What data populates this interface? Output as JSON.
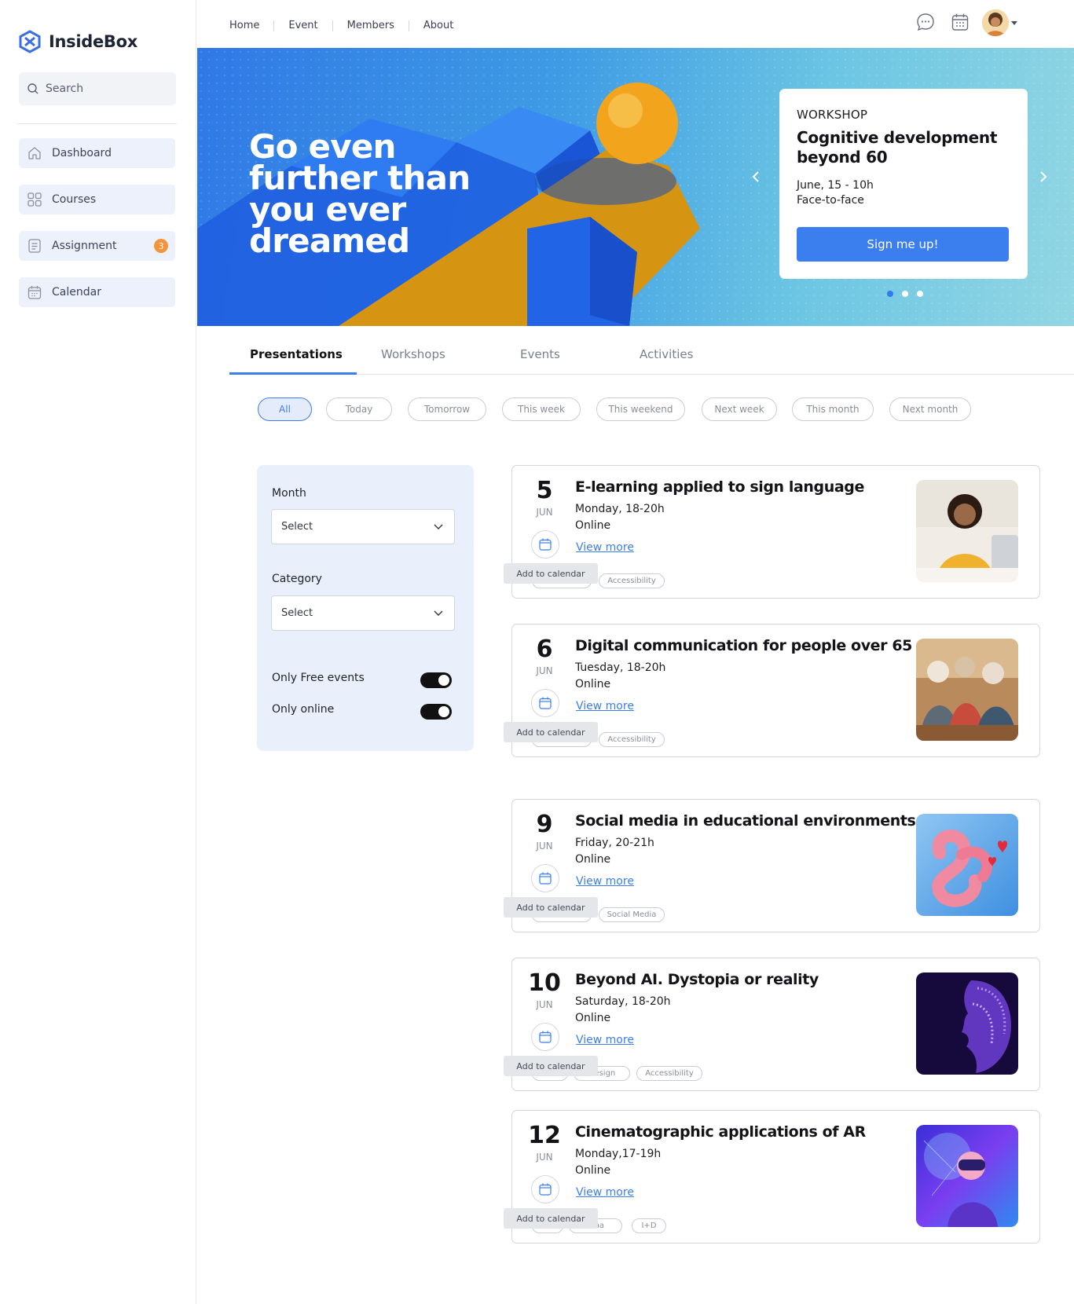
{
  "brand": {
    "name": "InsideBox"
  },
  "search": {
    "placeholder": "Search"
  },
  "sidebar": {
    "items": [
      {
        "label": "Dashboard",
        "icon": "home-icon"
      },
      {
        "label": "Courses",
        "icon": "grid-icon"
      },
      {
        "label": "Assignment",
        "icon": "document-icon",
        "badge": "3"
      },
      {
        "label": "Calendar",
        "icon": "calendar-icon"
      }
    ]
  },
  "topnav": {
    "links": [
      "Home",
      "Event",
      "Members",
      "About"
    ],
    "icons": [
      "chat-icon",
      "calendar-icon",
      "bell-icon"
    ]
  },
  "hero": {
    "title": "Go even further than you ever dreamed",
    "card": {
      "kind": "WORKSHOP",
      "title": "Cognitive development beyond 60",
      "date": "June, 15 - 10h",
      "mode": "Face-to-face",
      "cta": "Sign me up!"
    },
    "slides": 3,
    "active_slide": 1
  },
  "tabs": {
    "items": [
      "Presentations",
      "Workshops",
      "Events",
      "Activities"
    ],
    "active": "Presentations"
  },
  "chips": {
    "items": [
      "All",
      "Today",
      "Tomorrow",
      "This week",
      "This weekend",
      "Next week",
      "This month",
      "Next month"
    ],
    "active": "All"
  },
  "filters": {
    "month_label": "Month",
    "month_value": "Select",
    "category_label": "Category",
    "category_value": "Select",
    "free_label": "Only Free events",
    "free_on": true,
    "online_label": "Only online",
    "online_on": true
  },
  "events": [
    {
      "day": "5",
      "month": "JUN",
      "title": "E-learning applied to sign language",
      "when": "Monday, 18-20h",
      "where": "Online",
      "more": "View more",
      "tooltip": "Add to calendar",
      "tags": [
        "Accessibility"
      ]
    },
    {
      "day": "6",
      "month": "JUN",
      "title": "Digital communication for people over 65",
      "when": "Tuesday, 18-20h",
      "where": "Online",
      "more": "View more",
      "tooltip": "Add to calendar",
      "tags": [
        "Accessibility"
      ]
    },
    {
      "day": "9",
      "month": "JUN",
      "title": "Social media in educational environments",
      "when": "Friday, 20-21h",
      "where": "Online",
      "more": "View more",
      "tooltip": "Add to calendar",
      "tags": [
        "Social Media"
      ]
    },
    {
      "day": "10",
      "month": "JUN",
      "title": "Beyond AI. Dystopia or reality",
      "when": "Saturday, 18-20h",
      "where": "Online",
      "more": "View more",
      "tooltip": "Add to calendar",
      "tags": [
        "Design",
        "Accessibility"
      ]
    },
    {
      "day": "12",
      "month": "JUN",
      "title": "Cinematographic applications of AR",
      "when": "Monday,17-19h",
      "where": "Online",
      "more": "View more",
      "tooltip": "Add to calendar",
      "tags": [
        "ema",
        "I+D"
      ]
    }
  ],
  "colors": {
    "accent": "#3b7eee",
    "badge": "#f3933a",
    "filter_bg": "#eaf0fb",
    "nav_bg": "#ecf1fb"
  }
}
